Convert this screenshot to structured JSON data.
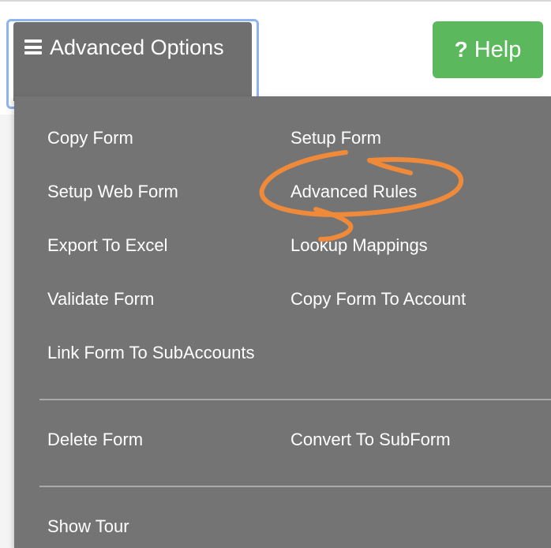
{
  "trigger": {
    "icon": "hamburger-menu-icon",
    "label": "Advanced Options"
  },
  "help": {
    "icon": "question-mark-icon",
    "icon_glyph": "?",
    "label": "Help",
    "color": "#5cb85c"
  },
  "menu": {
    "background": "#747474",
    "items": [
      {
        "label": "Copy Form"
      },
      {
        "label": "Setup Form"
      },
      {
        "label": "Setup Web Form"
      },
      {
        "label": "Advanced Rules"
      },
      {
        "label": "Export To Excel"
      },
      {
        "label": "Lookup Mappings"
      },
      {
        "label": "Validate Form"
      },
      {
        "label": "Copy Form To Account"
      },
      {
        "label": "Link Form To SubAccounts"
      },
      {
        "label": "Delete Form"
      },
      {
        "label": "Convert To SubForm"
      },
      {
        "label": "Show Tour"
      }
    ]
  },
  "annotation": {
    "type": "hand-drawn-circle-arrow",
    "color": "#ef8a3a",
    "target": "Advanced Rules"
  }
}
